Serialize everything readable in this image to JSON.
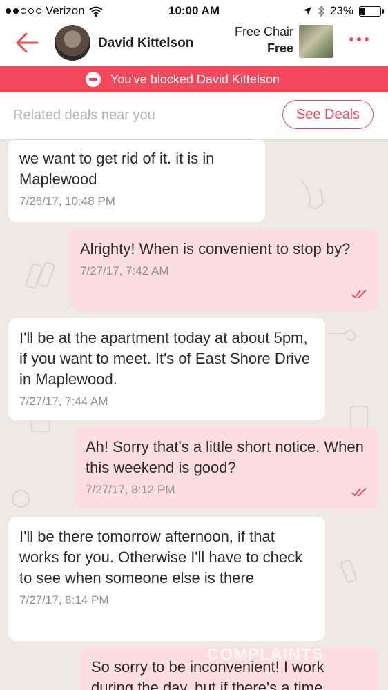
{
  "status_bar": {
    "carrier": "Verizon",
    "time": "10:00 AM",
    "battery": "23%",
    "battery_level": 0.23
  },
  "header": {
    "contact_name": "David Kittelson",
    "deal_title": "Free Chair",
    "deal_price": "Free"
  },
  "blocked_banner": {
    "text": "You've blocked David Kittelson"
  },
  "related": {
    "placeholder": "Related deals near you",
    "button_label": "See Deals"
  },
  "messages": [
    {
      "direction": "in",
      "text": "we want to get rid of it. it is in Maplewood",
      "timestamp": "7/26/17, 10:48 PM"
    },
    {
      "direction": "out",
      "text": "Alrighty! When is convenient to stop by?",
      "timestamp": "7/27/17, 7:42 AM"
    },
    {
      "direction": "in",
      "text": "I'll be at the apartment today at about 5pm, if you want to meet. It's of East Shore Drive in Maplewood.",
      "timestamp": "7/27/17, 7:44 AM"
    },
    {
      "direction": "out",
      "text": "Ah! Sorry that's a little short notice. When this weekend is good?",
      "timestamp": "7/27/17, 8:12 PM"
    },
    {
      "direction": "in",
      "text": "I'll be there tomorrow afternoon, if that works for you. Otherwise I'll have to check to see when someone else is there",
      "timestamp": "7/27/17, 8:14 PM"
    },
    {
      "direction": "out",
      "text": "So sorry to be inconvenient! I work during the day, but if there's a time"
    }
  ],
  "colors": {
    "accent": "#f2485a",
    "banner": "#f4495c",
    "outgoing_bubble": "#fcdde1",
    "incoming_bubble": "#ffffff",
    "background": "#efe9e6"
  },
  "icons": [
    "back-arrow-icon",
    "more-icon",
    "blocked-icon",
    "read-check-icon",
    "wifi-icon",
    "location-icon",
    "bluetooth-icon"
  ]
}
